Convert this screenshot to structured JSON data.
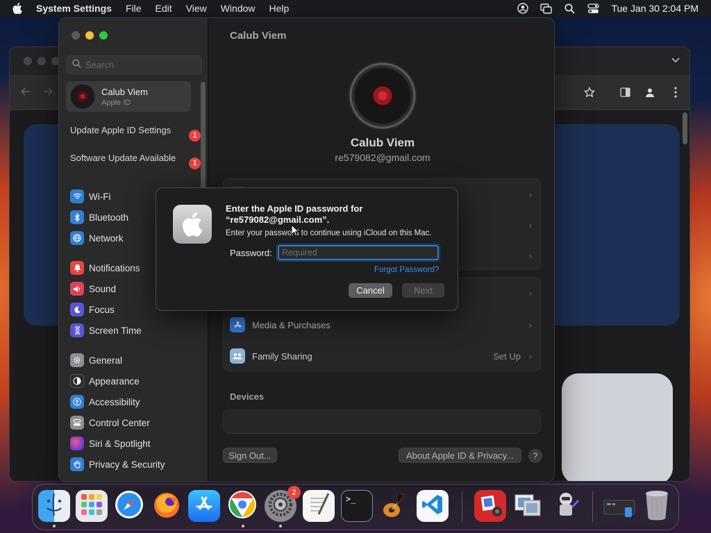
{
  "menubar": {
    "app_name": "System Settings",
    "menus": [
      "File",
      "Edit",
      "View",
      "Window",
      "Help"
    ],
    "clock": "Tue Jan 30  2:04 PM"
  },
  "sidebar": {
    "search_placeholder": "Search",
    "account": {
      "name": "Calub Viem",
      "subtitle": "Apple ID"
    },
    "notices": [
      {
        "label": "Update Apple ID Settings",
        "badge": "1"
      },
      {
        "label": "Software Update Available",
        "badge": "1"
      }
    ],
    "items": [
      {
        "label": "Wi-Fi",
        "icon": "wifi-icon",
        "color": "#2f7fd6"
      },
      {
        "label": "Bluetooth",
        "icon": "bluetooth-icon",
        "color": "#2f7fd6"
      },
      {
        "label": "Network",
        "icon": "globe-icon",
        "color": "#2f7fd6"
      },
      {
        "label": "Notifications",
        "icon": "bell-icon",
        "color": "#e6463f"
      },
      {
        "label": "Sound",
        "icon": "speaker-icon",
        "color": "#e2415a"
      },
      {
        "label": "Focus",
        "icon": "moon-icon",
        "color": "#5856d6"
      },
      {
        "label": "Screen Time",
        "icon": "hourglass-icon",
        "color": "#5856d6"
      },
      {
        "label": "General",
        "icon": "gear-icon",
        "color": "#8e8e93"
      },
      {
        "label": "Appearance",
        "icon": "appearance-icon",
        "color": "#2c2c2e"
      },
      {
        "label": "Accessibility",
        "icon": "accessibility-icon",
        "color": "#2f7fd6"
      },
      {
        "label": "Control Center",
        "icon": "control-center-icon",
        "color": "#8e8e93"
      },
      {
        "label": "Siri & Spotlight",
        "icon": "siri-icon",
        "color": "#b04ad6"
      },
      {
        "label": "Privacy & Security",
        "icon": "hand-icon",
        "color": "#2f7fd6"
      }
    ]
  },
  "main": {
    "title": "Calub Viem",
    "name": "Calub Viem",
    "email": "re579082@gmail.com",
    "rows": [
      {
        "label": "Media & Purchases",
        "value": ""
      },
      {
        "label": "Family Sharing",
        "value": "Set Up"
      }
    ],
    "devices_label": "Devices",
    "sign_out": "Sign Out...",
    "about": "About Apple ID & Privacy...",
    "help": "?"
  },
  "dialog": {
    "title": "Enter the Apple ID password for “re579082@gmail.com”.",
    "description": "Enter your password to continue using iCloud on this Mac.",
    "password_label": "Password:",
    "password_placeholder": "Required",
    "password_value": "",
    "forgot": "Forgot Password?",
    "cancel": "Cancel",
    "next": "Next"
  },
  "dock": {
    "apps": [
      {
        "name": "Finder",
        "icon": "finder-icon",
        "running": true
      },
      {
        "name": "Launchpad",
        "icon": "launchpad-icon",
        "running": false
      },
      {
        "name": "Safari",
        "icon": "safari-icon",
        "running": false
      },
      {
        "name": "Firefox",
        "icon": "firefox-icon",
        "running": false
      },
      {
        "name": "App Store",
        "icon": "app-store-icon",
        "running": false
      },
      {
        "name": "Chrome",
        "icon": "chrome-icon",
        "running": true
      },
      {
        "name": "System Settings",
        "icon": "system-settings-icon",
        "running": true,
        "badge": "2"
      },
      {
        "name": "TextEdit",
        "icon": "textedit-icon",
        "running": false
      },
      {
        "name": "Terminal",
        "icon": "terminal-icon",
        "running": false
      },
      {
        "name": "GarageBand",
        "icon": "garageband-icon",
        "running": false
      },
      {
        "name": "Visual Studio Code",
        "icon": "vscode-icon",
        "running": false
      },
      {
        "name": "Photo Booth",
        "icon": "photo-booth-icon",
        "running": false
      },
      {
        "name": "Preview",
        "icon": "preview-icon",
        "running": false
      },
      {
        "name": "Automator",
        "icon": "automator-icon",
        "running": false
      },
      {
        "name": "Downloads",
        "icon": "downloads-stack-icon",
        "running": false
      },
      {
        "name": "Trash",
        "icon": "trash-icon",
        "running": false
      }
    ]
  }
}
